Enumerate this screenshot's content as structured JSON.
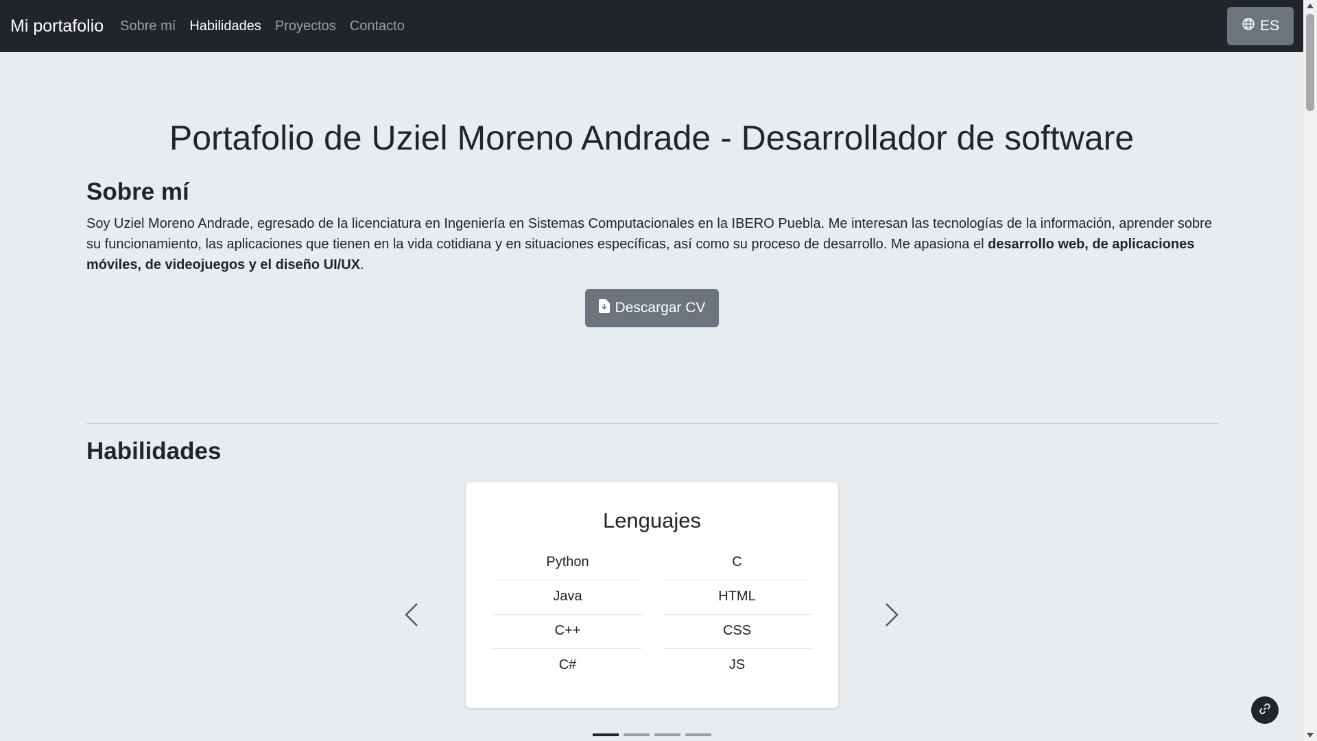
{
  "navbar": {
    "brand": "Mi portafolio",
    "links": [
      "Sobre mí",
      "Habilidades",
      "Proyectos",
      "Contacto"
    ],
    "active_link": "Habilidades",
    "language_button": {
      "icon": "globe-icon",
      "label": "ES"
    }
  },
  "main": {
    "title": "Portafolio de Uziel Moreno Andrade - Desarrollador de software",
    "about": {
      "heading": "Sobre mí",
      "text": "Soy Uziel Moreno Andrade, egresado de la licenciatura en Ingeniería en Sistemas Computacionales en la IBERO Puebla. Me interesan las tecnologías de la información, aprender sobre su funcionamiento, las aplicaciones que tienen en la vida cotidiana y en situaciones específicas, así como su proceso de desarrollo. Me apasiona el ",
      "text_bold": "desarrollo web, de aplicaciones móviles, de videojuegos y el diseño UI/UX",
      "text_end": ".",
      "cv_button": {
        "icon": "file-download-icon",
        "label": "Descargar CV"
      }
    },
    "skills": {
      "heading": "Habilidades",
      "carousel": {
        "card_title": "Lenguajes",
        "left_column": [
          "Python",
          "Java",
          "C++",
          "C#"
        ],
        "right_column": [
          "C",
          "HTML",
          "CSS",
          "JS"
        ],
        "indicator_count": 4,
        "active_indicator": 1,
        "prev_icon": "chevron-left-icon",
        "next_icon": "chevron-right-icon"
      }
    }
  },
  "floating_button": {
    "icon": "link-icon"
  },
  "colors": {
    "navbar_bg": "#212529",
    "page_bg": "#e9ecef",
    "button_bg": "#6c757d",
    "text": "#212529"
  }
}
